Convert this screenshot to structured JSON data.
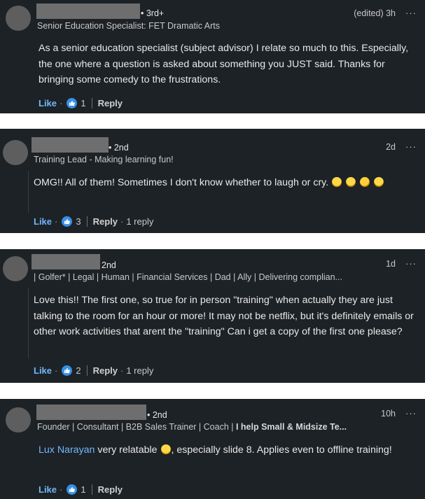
{
  "comments": [
    {
      "degree": "• 3rd+",
      "headline": "Senior Education Specialist: FET Dramatic Arts",
      "time": "(edited) 3h",
      "text": "As a senior education specialist (subject advisor) I relate so much to this. Especially, the one where a question is asked about something you JUST said. Thanks for bringing some comedy to the frustrations.",
      "like_label": "Like",
      "reaction_count": "1",
      "reply_label": "Reply",
      "replies": ""
    },
    {
      "degree": "• 2nd",
      "headline": "Training Lead - Making learning fun!",
      "time": "2d",
      "text": "OMG!! All of them! Sometimes I don't know whether to laugh or cry.",
      "like_label": "Like",
      "reaction_count": "3",
      "reply_label": "Reply",
      "replies": "1 reply"
    },
    {
      "degree": "2nd",
      "headline": "| Golfer* | Legal | Human | Financial Services | Dad | Ally | Delivering complian...",
      "time": "1d",
      "text": "Love this!! The first one, so true for in person \"training\" when actually they are just talking to the room for an hour or more! It may not be netflix, but it's definitely emails or other work activities that arent the \"training\" Can i get a copy of the first one please?",
      "like_label": "Like",
      "reaction_count": "2",
      "reply_label": "Reply",
      "replies": "1 reply"
    },
    {
      "degree": "• 2nd",
      "headline_plain": "Founder | Consultant | B2B Sales Trainer | Coach | ",
      "headline_bold": "I help Small & Midsize Te...",
      "time": "10h",
      "mention": "Lux Narayan",
      "text_after_mention": " very relatable ",
      "text_tail": ", especially slide 8. Applies even to offline training!",
      "like_label": "Like",
      "reaction_count": "1",
      "reply_label": "Reply",
      "replies": ""
    }
  ],
  "menu_glyph": "···",
  "separator": "·",
  "colors": {
    "card_bg": "#1d2226",
    "accent_blue": "#71b7fb",
    "like_badge": "#378fe9"
  }
}
